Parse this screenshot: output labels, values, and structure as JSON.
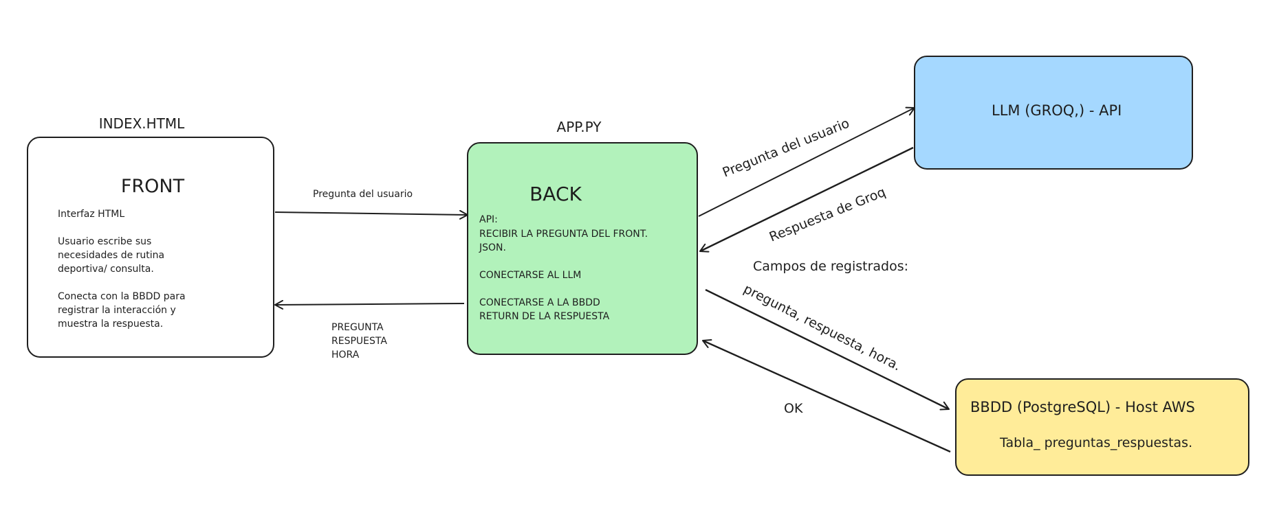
{
  "colors": {
    "stroke": "#1e1e1e",
    "front_fill": "#ffffff",
    "back_fill": "#b2f2bb",
    "llm_fill": "#a5d8ff",
    "db_fill": "#ffec99"
  },
  "front": {
    "caption": "INDEX.HTML",
    "title": "FRONT",
    "lines": [
      "Interfaz HTML",
      "",
      "Usuario escribe sus",
      "necesidades de rutina",
      "deportiva/ consulta.",
      "",
      "Conecta con la BBDD para",
      "registrar la interacción y",
      "muestra la respuesta."
    ]
  },
  "back": {
    "caption": "APP.PY",
    "title": "BACK",
    "lines": [
      "API:",
      "RECIBIR LA PREGUNTA DEL FRONT.",
      "JSON.",
      "",
      "CONECTARSE AL LLM",
      "",
      "CONECTARSE A LA BBDD",
      "RETURN DE LA RESPUESTA"
    ]
  },
  "llm": {
    "title": "LLM (GROQ,) - API"
  },
  "db": {
    "title": "BBDD (PostgreSQL) - Host AWS",
    "subtitle": "Tabla_ preguntas_respuestas."
  },
  "edges": {
    "front_to_back": "Pregunta del usuario",
    "back_to_front": [
      "PREGUNTA",
      "RESPUESTA",
      "HORA"
    ],
    "back_to_llm": "Pregunta del usuario",
    "llm_to_back": "Respuesta de Groq",
    "back_to_db": [
      "Campos de registrados:",
      "pregunta, respuesta, hora."
    ],
    "db_to_back": "OK"
  }
}
